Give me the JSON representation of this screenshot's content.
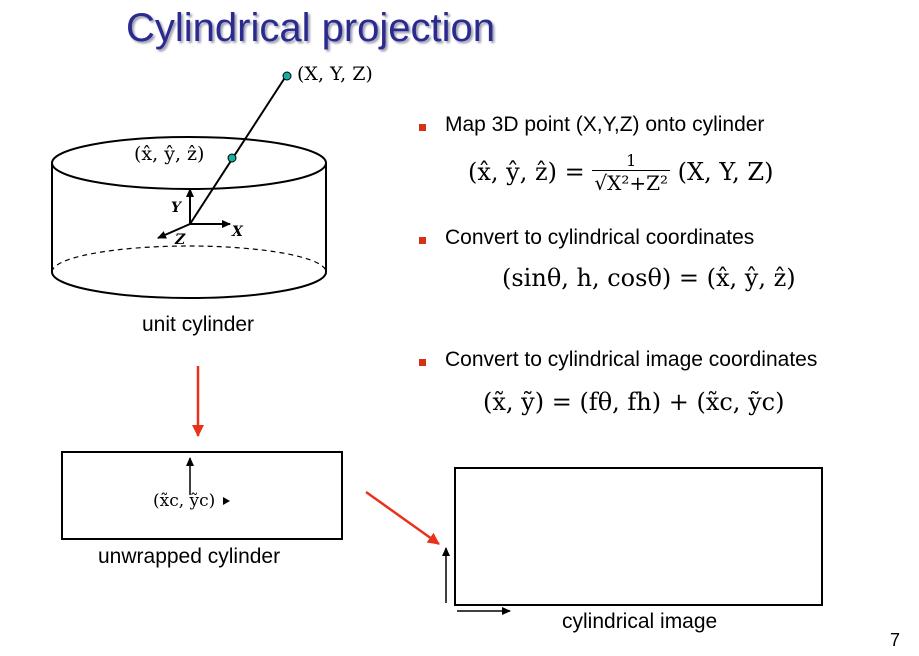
{
  "slide": {
    "title": "Cylindrical projection",
    "page_number": "7"
  },
  "bullets": [
    {
      "text": "Map 3D point (X,Y,Z) onto cylinder"
    },
    {
      "text": "Convert to cylindrical coordinates"
    },
    {
      "text": "Convert to cylindrical image coordinates"
    }
  ],
  "equations": {
    "eq1_lhs": "(x̂, ŷ, ẑ) =",
    "eq1_num": "1",
    "eq1_den": "√X²+Z²",
    "eq1_rhs": "(X, Y, Z)",
    "eq2": "(sinθ, h, cosθ) = (x̂, ŷ, ẑ)",
    "eq3": "(x̃, ỹ) = (fθ, fh) + (x̃c, ỹc)"
  },
  "diagram": {
    "point_label": "(X, Y, Z)",
    "proj_label": "(x̂, ŷ, ẑ)",
    "axis_x": "X",
    "axis_y": "Y",
    "axis_z": "Z",
    "cylinder_caption": "unit cylinder",
    "center_label": "(x̃c, ỹc)",
    "unwrapped_caption": "unwrapped cylinder",
    "image_caption": "cylindrical image"
  },
  "colors": {
    "title": "#2b2b8f",
    "bullet": "#d43212",
    "arrow_red": "#e8321a",
    "point": "#16b0a0"
  }
}
